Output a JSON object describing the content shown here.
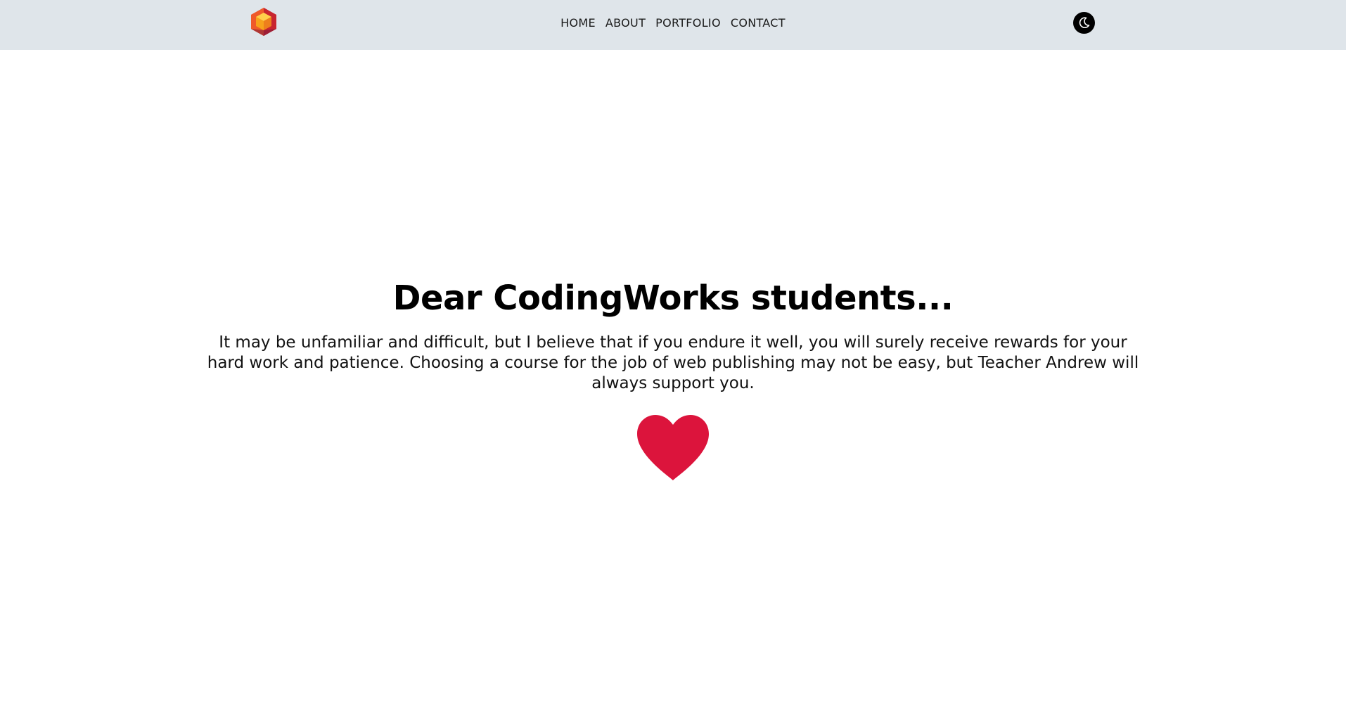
{
  "header": {
    "logo_icon": "hexagon-cube-logo-icon",
    "nav": [
      {
        "label": "HOME"
      },
      {
        "label": "ABOUT"
      },
      {
        "label": "PORTFOLIO"
      },
      {
        "label": "CONTACT"
      }
    ],
    "theme_toggle_icon": "moon-icon"
  },
  "main": {
    "title": "Dear CodingWorks students...",
    "message": "It may be unfamiliar and difficult, but I believe that if you endure it well, you will surely receive rewards for your hard work and patience. Choosing a course for the job of web publishing may not be easy, but Teacher Andrew will always support you.",
    "heart_icon": "heart-icon"
  },
  "colors": {
    "header_bg": "#dfe5ea",
    "heart": "#dc143c",
    "logo_primary": "#e8402a",
    "logo_accent": "#f7a21b"
  }
}
